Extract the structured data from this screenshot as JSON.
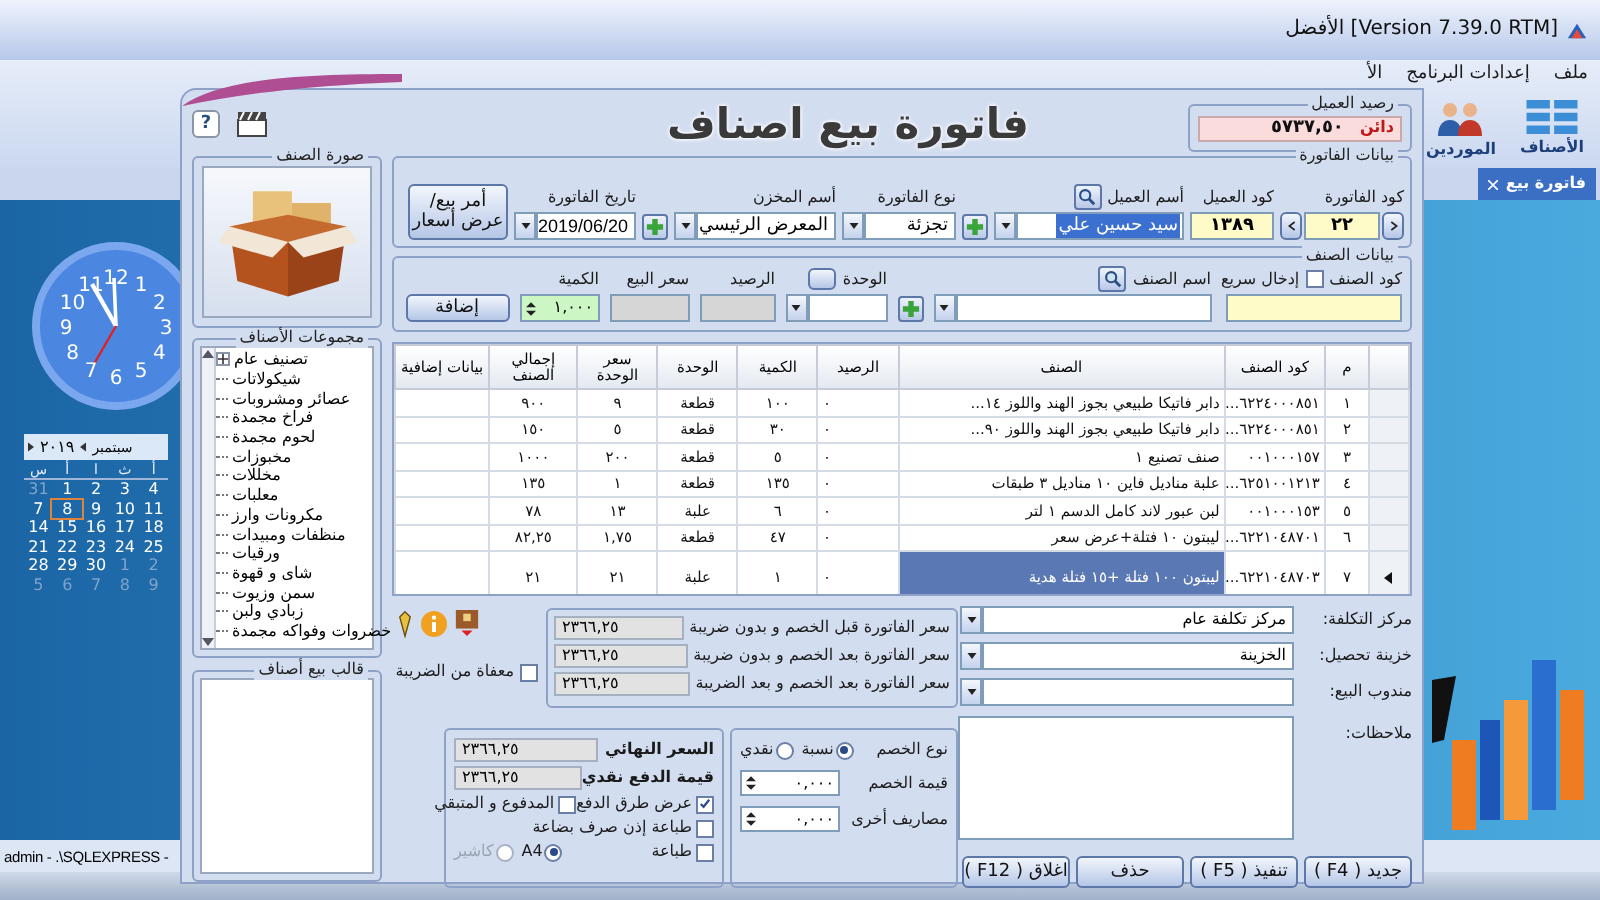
{
  "app": {
    "title": "الأفضل [Version 7.39.0 RTM]",
    "menu": [
      {
        "label": "ملف"
      },
      {
        "label": "إعدادات البرنامج"
      },
      {
        "label": "الأ"
      }
    ],
    "toolbar": [
      {
        "label": "الأصناف",
        "kind": "items"
      },
      {
        "label": "الموردين",
        "kind": "people"
      }
    ],
    "tabs": [
      {
        "label": "فاتورة بيع",
        "selected": true
      }
    ],
    "status_bar": "admin - .\\SQLEXPRESS -"
  },
  "clock": {
    "numerals": [
      "12",
      "1",
      "11",
      "2",
      "10",
      "3",
      "9",
      "4",
      "8",
      "5",
      "7",
      "6"
    ]
  },
  "calendar": {
    "month": "سبتمبر",
    "year": "٢٠١٩",
    "weekdays": [
      "أ",
      "ث",
      "ا",
      "أ",
      "س"
    ],
    "weeks": [
      [
        {
          "day": "4",
          "outside": false,
          "selected": false
        },
        {
          "day": "3",
          "outside": false,
          "selected": false
        },
        {
          "day": "2",
          "outside": false,
          "selected": false
        },
        {
          "day": "1",
          "outside": false,
          "selected": false
        },
        {
          "day": "31",
          "outside": true,
          "selected": false
        }
      ],
      [
        {
          "day": "11",
          "outside": false,
          "selected": false
        },
        {
          "day": "10",
          "outside": false,
          "selected": false
        },
        {
          "day": "9",
          "outside": false,
          "selected": false
        },
        {
          "day": "8",
          "outside": false,
          "selected": true
        },
        {
          "day": "7",
          "outside": false,
          "selected": false
        }
      ],
      [
        {
          "day": "18",
          "outside": false,
          "selected": false
        },
        {
          "day": "17",
          "outside": false,
          "selected": false
        },
        {
          "day": "16",
          "outside": false,
          "selected": false
        },
        {
          "day": "15",
          "outside": false,
          "selected": false
        },
        {
          "day": "14",
          "outside": false,
          "selected": false
        }
      ],
      [
        {
          "day": "25",
          "outside": false,
          "selected": false
        },
        {
          "day": "24",
          "outside": false,
          "selected": false
        },
        {
          "day": "23",
          "outside": false,
          "selected": false
        },
        {
          "day": "22",
          "outside": false,
          "selected": false
        },
        {
          "day": "21",
          "outside": false,
          "selected": false
        }
      ],
      [
        {
          "day": "2",
          "outside": true,
          "selected": false
        },
        {
          "day": "1",
          "outside": true,
          "selected": false
        },
        {
          "day": "30",
          "outside": false,
          "selected": false
        },
        {
          "day": "29",
          "outside": false,
          "selected": false
        },
        {
          "day": "28",
          "outside": false,
          "selected": false
        }
      ],
      [
        {
          "day": "9",
          "outside": true,
          "selected": false
        },
        {
          "day": "8",
          "outside": true,
          "selected": false
        },
        {
          "day": "7",
          "outside": true,
          "selected": false
        },
        {
          "day": "6",
          "outside": true,
          "selected": false
        },
        {
          "day": "5",
          "outside": true,
          "selected": false
        }
      ]
    ]
  },
  "dialog": {
    "title": "فاتورة بيع اصناف",
    "help": "?",
    "balance": {
      "label": "رصيد العميل",
      "type": "دائن",
      "value": "٥٧٣٧,٥٠"
    },
    "picture_label": "صورة الصنف",
    "invoice": {
      "label": "بيانات الفاتورة",
      "code": {
        "label": "كود الفاتورة",
        "value": "٢٢"
      },
      "customer_code": {
        "label": "كود العميل",
        "value": "١٣٨٩"
      },
      "customer_name": {
        "label": "أسم العميل",
        "value": "سيد حسين علي"
      },
      "type": {
        "label": "نوع الفاتورة",
        "value": "تجزئة"
      },
      "store": {
        "label": "أسم المخزن",
        "value": "المعرض الرئيسي"
      },
      "date": {
        "label": "تاريخ الفاتورة",
        "value": "2019/06/20"
      },
      "order_button": "أمر بيع/ عرض أسعار"
    },
    "item": {
      "label": "بيانات الصنف",
      "code_label": "كود الصنف",
      "quick_entry": {
        "label": "إدخال سريع",
        "checked": false
      },
      "name_label": "اسم الصنف",
      "unit_label": "الوحدة",
      "balance_label": "الرصيد",
      "price_label": "سعر البيع",
      "qty": {
        "label": "الكمية",
        "value": "١,٠٠٠"
      },
      "add_button": "إضافة"
    },
    "groups": {
      "label": "مجموعات الأصناف",
      "tree": [
        {
          "label": "تصنيف عام",
          "expanded": true,
          "children": [
            {
              "label": "شيكولاتات"
            },
            {
              "label": "عصائر ومشروبات"
            },
            {
              "label": "فراخ مجمدة"
            },
            {
              "label": "لحوم مجمدة"
            },
            {
              "label": "مخبوزات"
            },
            {
              "label": "مخللات"
            },
            {
              "label": "معلبات"
            },
            {
              "label": "مكرونات وارز"
            },
            {
              "label": "منظفات ومبيدات"
            },
            {
              "label": "ورقيات"
            },
            {
              "label": "شاى و قهوة"
            },
            {
              "label": "سمن وزيوت"
            },
            {
              "label": "زبادي ولبن"
            },
            {
              "label": "خضروات وفواكه مجمدة"
            }
          ]
        }
      ]
    },
    "template_label": "قالب بيع أصناف",
    "table": {
      "columns": [
        "م",
        "كود الصنف",
        "الصنف",
        "الرصيد",
        "الكمية",
        "الوحدة",
        "سعر الوحدة",
        "إجمالي الصنف",
        "بيانات إضافية"
      ],
      "rows": [
        {
          "selected": false,
          "cells": [
            "١",
            "٦٢٢٤٠٠٠٨٥١...",
            "دابر فاتيكا  طبيعي بجوز الهند واللوز ١٤...",
            "٠",
            "١٠٠",
            "قطعة",
            "٩",
            "٩٠٠"
          ]
        },
        {
          "selected": false,
          "cells": [
            "٢",
            "٦٢٢٤٠٠٠٨٥١...",
            "دابر فاتيكا  طبيعي بجوز الهند واللوز ٩٠...",
            "٠",
            "٣٠",
            "قطعة",
            "٥",
            "١٥٠"
          ]
        },
        {
          "selected": false,
          "cells": [
            "٣",
            "٠٠١٠٠٠١٥٧",
            "صنف تصنيع ١",
            "٠",
            "٥",
            "قطعة",
            "٢٠٠",
            "١٠٠٠"
          ]
        },
        {
          "selected": false,
          "cells": [
            "٤",
            "٦٢٥١٠٠١٢١٣...",
            "علبة مناديل فاين ١٠ مناديل ٣ طبقات",
            "٠",
            "١٣٥",
            "قطعة",
            "١",
            "١٣٥"
          ]
        },
        {
          "selected": false,
          "cells": [
            "٥",
            "٠٠١٠٠٠١٥٣",
            "لبن عبور لاند كامل الدسم ١ لتر",
            "٠",
            "٦",
            "علبة",
            "١٣",
            "٧٨"
          ]
        },
        {
          "selected": false,
          "cells": [
            "٦",
            "٦٢٢١٠٤٨٧٠١...",
            "ليبتون ١٠ فتلة+عرض سعر",
            "٠",
            "٤٧",
            "قطعة",
            "١,٧٥",
            "٨٢,٢٥"
          ]
        },
        {
          "selected": true,
          "cells": [
            "٧",
            "٦٢٢١٠٤٨٧٠٣...",
            "ليبتون ١٠٠ فتلة +١٥ فتلة هدية",
            "٠",
            "١",
            "علبة",
            "٢١",
            "٢١"
          ]
        }
      ]
    },
    "cost_center": {
      "label": "مركز التكلفة:",
      "value": "مركز تكلفة عام"
    },
    "treasury": {
      "label": "خزينة تحصيل:",
      "value": "الخزينة"
    },
    "salesman": {
      "label": "مندوب البيع:"
    },
    "notes": {
      "label": "ملاحظات:"
    },
    "totals": [
      {
        "label": "سعر الفاتورة قبل الخصم و بدون ضريبة",
        "value": "٢٣٦٦,٢٥"
      },
      {
        "label": "سعر الفاتورة بعد الخصم و بدون ضريبة",
        "value": "٢٣٦٦,٢٥"
      },
      {
        "label": "سعر الفاتورة بعد الخصم و بعد الضريبة",
        "value": "٢٣٦٦,٢٥"
      }
    ],
    "tax_exempt": {
      "label": "معفاة من الضريبة",
      "checked": false
    },
    "discount": {
      "type_label": "نوع الخصم",
      "types": [
        {
          "label": "نسبة",
          "selected": true
        },
        {
          "label": "نقدي",
          "selected": false
        }
      ],
      "amount": {
        "label": "قيمة الخصم",
        "value": "٠,٠٠٠"
      },
      "other": {
        "label": "مصاريف أخرى",
        "value": "٠,٠٠٠"
      }
    },
    "payment": {
      "final": {
        "label": "السعر النهائي",
        "value": "٢٣٦٦,٢٥"
      },
      "cash": {
        "label": "قيمة الدفع نقدي",
        "value": "٢٣٦٦,٢٥"
      },
      "options": [
        {
          "label": "عرض طرق الدفع",
          "checked": true
        },
        {
          "label": "المدفوع و المتبقي",
          "checked": false
        },
        {
          "label": "طباعة إذن صرف بضاعة",
          "checked": false
        },
        {
          "label": "طباعة",
          "checked": false
        }
      ],
      "paper": [
        {
          "label": "A4",
          "selected": true,
          "disabled": false
        },
        {
          "label": "كاشير",
          "selected": false,
          "disabled": true
        }
      ]
    },
    "buttons": [
      "جديد ( F4 )",
      "تنفيذ ( F5 )",
      "حذف",
      "اغلاق ( F12 )"
    ]
  }
}
